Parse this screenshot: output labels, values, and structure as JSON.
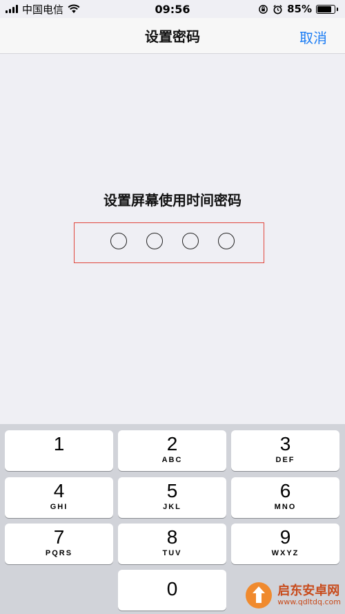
{
  "status_bar": {
    "carrier": "中国电信",
    "time": "09:56",
    "battery_percent": "85%",
    "battery_level": 0.85
  },
  "nav": {
    "title": "设置密码",
    "cancel_label": "取消"
  },
  "passcode": {
    "prompt": "设置屏幕使用时间密码",
    "digit_count": 4
  },
  "keypad": {
    "keys": [
      {
        "digit": "1",
        "letters": ""
      },
      {
        "digit": "2",
        "letters": "ABC"
      },
      {
        "digit": "3",
        "letters": "DEF"
      },
      {
        "digit": "4",
        "letters": "GHI"
      },
      {
        "digit": "5",
        "letters": "JKL"
      },
      {
        "digit": "6",
        "letters": "MNO"
      },
      {
        "digit": "7",
        "letters": "PQRS"
      },
      {
        "digit": "8",
        "letters": "TUV"
      },
      {
        "digit": "9",
        "letters": "WXYZ"
      },
      {
        "digit": "0",
        "letters": ""
      }
    ]
  },
  "watermark": {
    "name": "启东安卓网",
    "url": "www.qdltdq.com"
  },
  "colors": {
    "accent": "#1a7cf4",
    "highlight_box": "#e0463c",
    "background": "#efeff4",
    "keypad_bg": "#d1d3d9"
  }
}
